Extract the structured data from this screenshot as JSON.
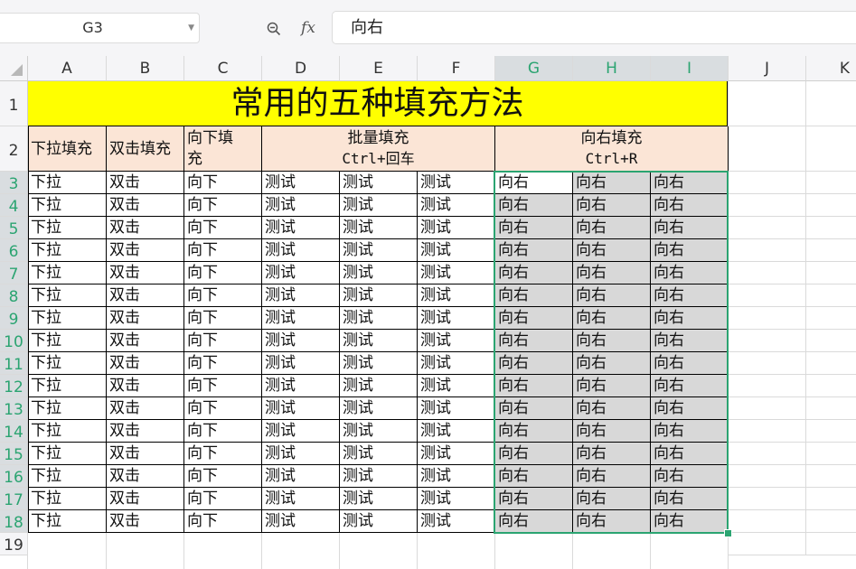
{
  "namebox": {
    "value": "G3"
  },
  "formula_bar": {
    "value": "向右"
  },
  "icons": {
    "zoom": "zoom-icon",
    "fx": "fx"
  },
  "columns": [
    "A",
    "B",
    "C",
    "D",
    "E",
    "F",
    "G",
    "H",
    "I",
    "J",
    "K"
  ],
  "rows": [
    "1",
    "2",
    "3",
    "4",
    "5",
    "6",
    "7",
    "8",
    "9",
    "10",
    "11",
    "12",
    "13",
    "14",
    "15",
    "16",
    "17",
    "18",
    "19"
  ],
  "sheet": {
    "title": "常用的五种填充方法",
    "headers": {
      "A": "下拉填充",
      "B": "双击填充",
      "C_line1": "向下填",
      "C_line2": "充",
      "DF_line1": "批量填充",
      "DF_line2": "Ctrl+回车",
      "GI_line1": "向右填充",
      "GI_line2": "Ctrl+R"
    },
    "cell_values": {
      "A": "下拉",
      "B": "双击",
      "C": "向下",
      "D": "测试",
      "E": "测试",
      "F": "测试",
      "G": "向右",
      "H": "向右",
      "I": "向右"
    }
  },
  "colors": {
    "accent": "#2ba471",
    "title_fill": "#ffff00",
    "header_fill": "#fbe5d6",
    "selected_fill": "#d8d8d8"
  }
}
